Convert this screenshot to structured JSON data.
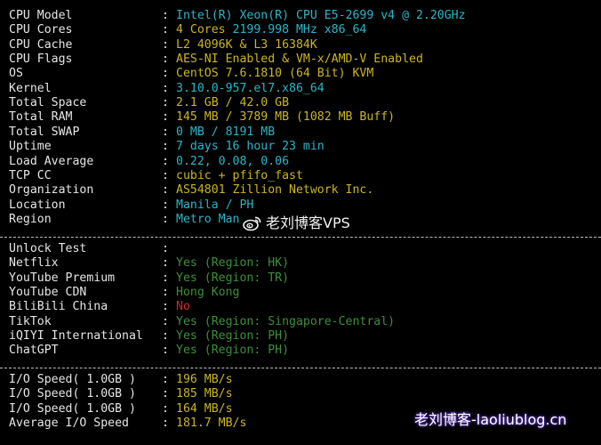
{
  "system": [
    {
      "label": "CPU Model",
      "value": "Intel(R) Xeon(R) CPU E5-2699 v4 @ 2.20GHz",
      "color": "cyan"
    },
    {
      "label": "CPU Cores",
      "value": "4 Cores 2199.998 MHz x86_64",
      "color": "cyan",
      "split": [
        {
          "text": "4 Cores",
          "color": "yellow"
        },
        {
          "text": " 2199.998 MHz x86_64",
          "color": "cyan"
        }
      ]
    },
    {
      "label": "CPU Cache",
      "value": "L2 4096K & L3 16384K",
      "color": "yellow"
    },
    {
      "label": "CPU Flags",
      "value": "AES-NI Enabled & VM-x/AMD-V Enabled",
      "color": "yellow"
    },
    {
      "label": "OS",
      "value": "CentOS 7.6.1810 (64 Bit) KVM",
      "color": "yellow"
    },
    {
      "label": "Kernel",
      "value": "3.10.0-957.el7.x86_64",
      "color": "cyan"
    },
    {
      "label": "Total Space",
      "value": "2.1 GB / 42.0 GB",
      "color": "yellow"
    },
    {
      "label": "Total RAM",
      "value": "145 MB / 3789 MB (1082 MB Buff)",
      "color": "yellow"
    },
    {
      "label": "Total SWAP",
      "value": "0 MB / 8191 MB",
      "color": "cyan"
    },
    {
      "label": "Uptime",
      "value": "7 days 16 hour 23 min",
      "color": "cyan"
    },
    {
      "label": "Load Average",
      "value": "0.22, 0.08, 0.06",
      "color": "cyan"
    },
    {
      "label": "TCP CC",
      "value": "cubic + pfifo_fast",
      "color": "yellow"
    },
    {
      "label": "Organization",
      "value": "AS54801 Zillion Network Inc.",
      "color": "yellow"
    },
    {
      "label": "Location",
      "value": "Manila / PH",
      "color": "cyan"
    },
    {
      "label": "Region",
      "value": "Metro Man",
      "color": "cyan"
    }
  ],
  "unlock": [
    {
      "label": "Unlock Test",
      "value": "",
      "color": "white"
    },
    {
      "label": "Netflix",
      "value": "Yes (Region: HK)",
      "color": "green"
    },
    {
      "label": "YouTube Premium",
      "value": "Yes (Region: TR)",
      "color": "green"
    },
    {
      "label": "YouTube CDN",
      "value": "Hong Kong",
      "color": "green"
    },
    {
      "label": "BiliBili China",
      "value": "No",
      "color": "red"
    },
    {
      "label": "TikTok",
      "value": "Yes (Region: Singapore-Central)",
      "color": "green"
    },
    {
      "label": "iQIYI International",
      "value": "Yes (Region: PH)",
      "color": "green"
    },
    {
      "label": "ChatGPT",
      "value": "Yes (Region: PH)",
      "color": "green"
    }
  ],
  "io": [
    {
      "label": "I/O Speed( 1.0GB )",
      "value": "196 MB/s",
      "color": "yellow"
    },
    {
      "label": "I/O Speed( 1.0GB )",
      "value": "185 MB/s",
      "color": "yellow"
    },
    {
      "label": "I/O Speed( 1.0GB )",
      "value": "164 MB/s",
      "color": "yellow"
    },
    {
      "label": "Average I/O Speed",
      "value": "181.7 MB/s",
      "color": "yellow"
    }
  ],
  "colon": ":",
  "watermark_top": "老刘博客VPS",
  "watermark_bottom": "老刘博客-laoliublog.cn",
  "colors": {
    "background": "#000000",
    "cyan": "#2bb5c8",
    "yellow": "#c9b523",
    "green": "#3d8f3a",
    "red": "#d32b2b",
    "label": "#e6e6e6"
  }
}
